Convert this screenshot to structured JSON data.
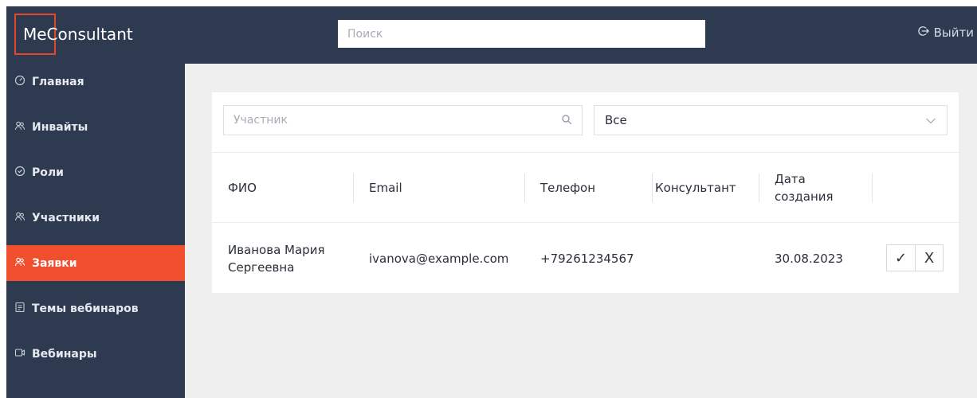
{
  "header": {
    "logo_text": "MeConsultant",
    "search_placeholder": "Поиск",
    "logout_label": "Выйти"
  },
  "sidebar": {
    "items": [
      {
        "label": "Главная",
        "icon": "dashboard-icon"
      },
      {
        "label": "Инвайты",
        "icon": "users-icon"
      },
      {
        "label": "Роли",
        "icon": "shield-icon"
      },
      {
        "label": "Участники",
        "icon": "users-icon"
      },
      {
        "label": "Заявки",
        "icon": "users-icon",
        "active": true
      },
      {
        "label": "Темы вебинаров",
        "icon": "document-icon"
      },
      {
        "label": "Вебинары",
        "icon": "video-icon"
      }
    ]
  },
  "filters": {
    "participant_placeholder": "Участник",
    "status_value": "Все"
  },
  "table": {
    "columns": [
      "ФИО",
      "Email",
      "Телефон",
      "Консультант",
      "Дата создания"
    ],
    "rows": [
      {
        "fio": "Иванова Мария Сергеевна",
        "email": "ivanova@example.com",
        "phone": "+79261234567",
        "consultant": "",
        "created": "30.08.2023",
        "approve": "✓",
        "reject": "X"
      }
    ]
  },
  "colors": {
    "navy": "#2e3a4f",
    "accent": "#f04e2c",
    "background": "#efefef"
  }
}
